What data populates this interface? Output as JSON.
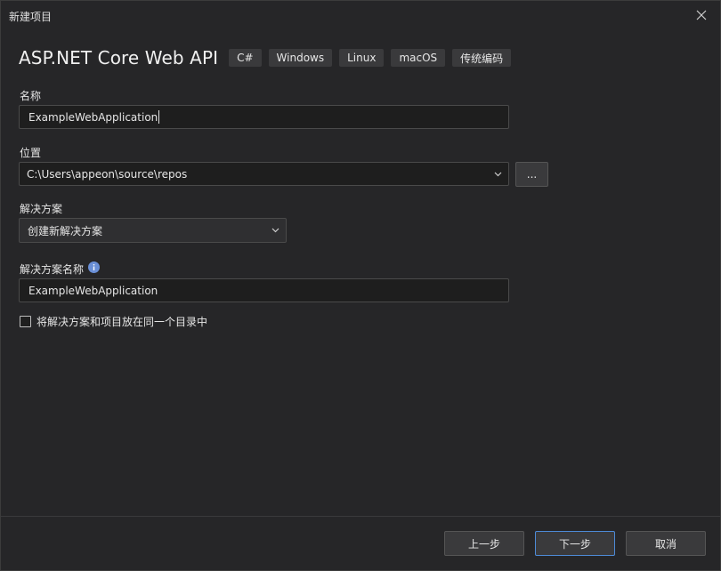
{
  "window": {
    "title": "新建项目"
  },
  "template": {
    "name": "ASP.NET Core Web API",
    "tags": [
      "C#",
      "Windows",
      "Linux",
      "macOS",
      "传统编码"
    ]
  },
  "form": {
    "name_label": "名称",
    "name_value": "ExampleWebApplication",
    "location_label": "位置",
    "location_value": "C:\\Users\\appeon\\source\\repos",
    "browse_label": "...",
    "solution_label": "解决方案",
    "solution_value": "创建新解决方案",
    "solution_name_label": "解决方案名称",
    "solution_name_value": "ExampleWebApplication",
    "same_dir_label": "将解决方案和项目放在同一个目录中",
    "same_dir_checked": false
  },
  "footer": {
    "back_label": "上一步",
    "next_label": "下一步",
    "cancel_label": "取消"
  },
  "colors": {
    "accent": "#4d8ad6",
    "info": "#6a8fd6"
  }
}
